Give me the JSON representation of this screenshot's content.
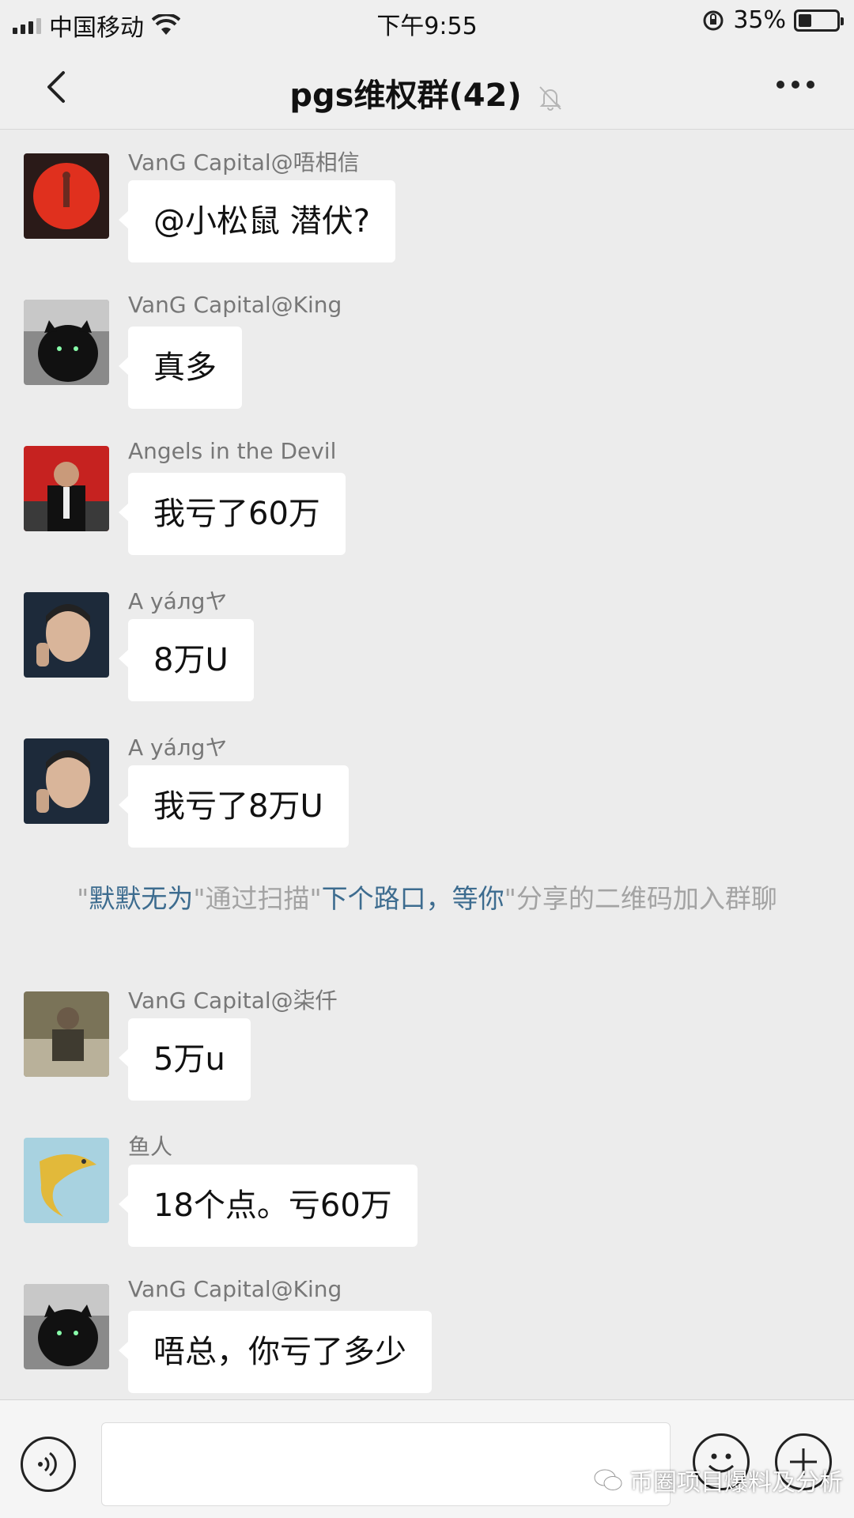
{
  "status_bar": {
    "carrier": "中国移动",
    "time": "下午9:55",
    "battery": "35%",
    "battery_level": 0.35
  },
  "header": {
    "title": "pgs维权群(42)",
    "back_icon": "chevron-left-icon",
    "mute_icon": "bell-off-icon",
    "more_icon": "more-dots-icon"
  },
  "messages": [
    {
      "sender": "VanG Capital@唔相信",
      "text": "@小松鼠 潜伏?"
    },
    {
      "sender": "VanG Capital@King",
      "text": "真多"
    },
    {
      "sender": "Angels in the Devil",
      "text": "我亏了60万"
    },
    {
      "sender": "A yáлgヤ",
      "text": "8万U"
    },
    {
      "sender": "A yáлgヤ",
      "text": "我亏了8万U"
    },
    {
      "sender": "VanG Capital@柒仟",
      "text": "5万u"
    },
    {
      "sender": "鱼人",
      "text": "18个点。亏60万"
    },
    {
      "sender": "VanG Capital@King",
      "text": "唔总，你亏了多少"
    }
  ],
  "system_notice": {
    "quote_open": "\"",
    "inviter": "默默无为",
    "middle": "\"通过扫描\"",
    "referrer": "下个路口，等你",
    "tail": "\"分享的二维码加入群聊"
  },
  "input_bar": {
    "voice_icon": "voice-icon",
    "emoji_icon": "emoji-icon",
    "plus_icon": "plus-icon"
  },
  "watermark": {
    "text": "币圈项目爆料及分析"
  }
}
